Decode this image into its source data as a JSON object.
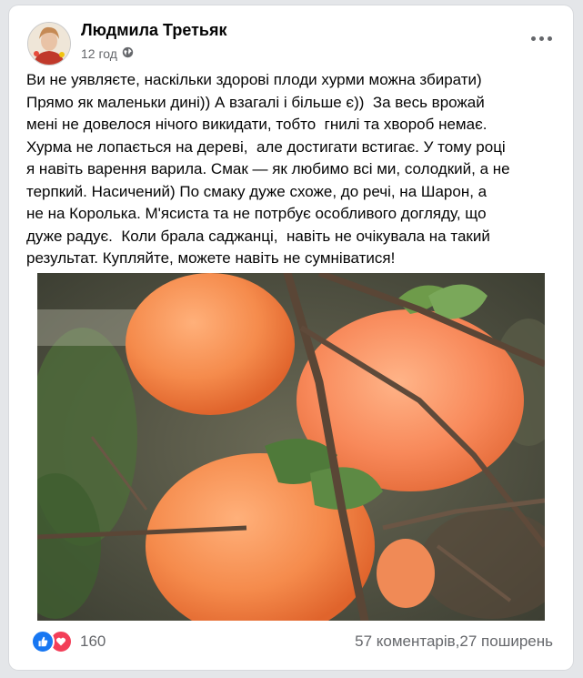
{
  "post": {
    "author": "Людмила Третьяк",
    "time": "12 год",
    "privacy_icon": "globe-icon",
    "text": "Ви не уявляєте, наскільки здорові плоди хурми можна збирати)\nПрямо як маленьки дині)) А взагалі і більше є))  За весь врожай\nмені не довелося нічого викидати, тобто  гнилі та хвороб немає.\nХурма не лопається на дереві,  але достигати встигає. У тому році\nя навіть варення варила. Смак — як любимо всі ми, солодкий, а не\nтерпкий. Насичений) По смаку дуже схоже, до речі, на Шарон, а\nне на Королька. М'ясиста та не потрбує особливого догляду, що\nдуже радує.  Коли брала саджанці,  навіть не очікувала на такий\nрезультат. Купляйте, можете навіть не сумніватися!"
  },
  "footer": {
    "reaction_count": "160",
    "comments": "57 коментарів,",
    "shares": "27 поширень"
  },
  "colors": {
    "accent": "#1877f2",
    "love": "#f33e58",
    "persimmon": "#f58b4c"
  }
}
